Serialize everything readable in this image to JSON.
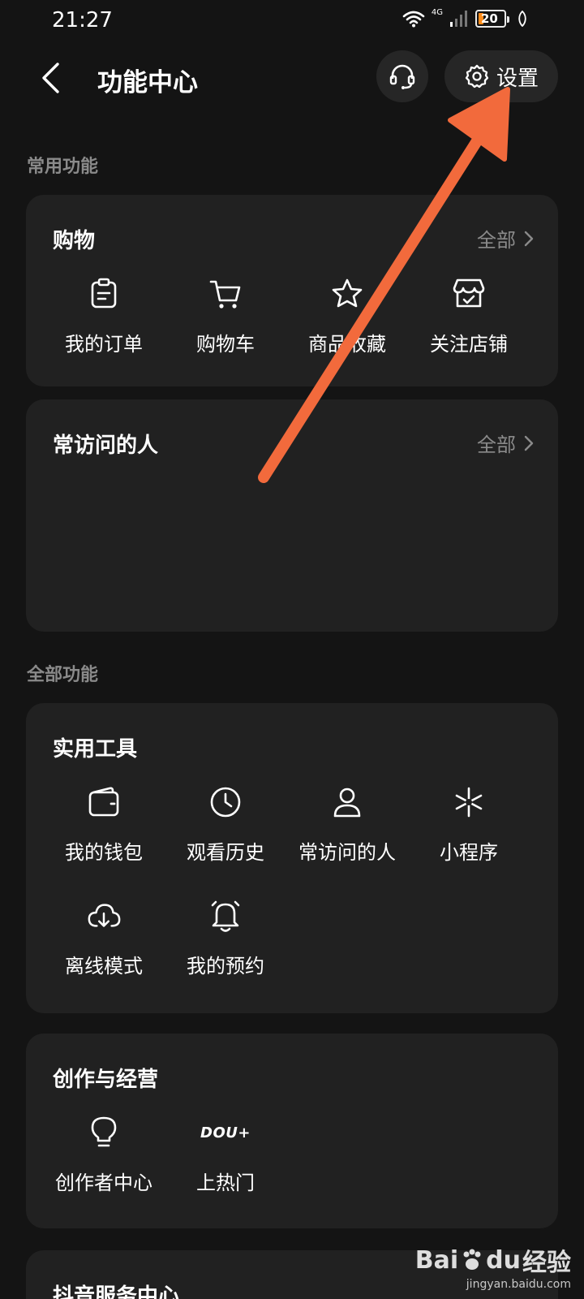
{
  "status_bar": {
    "time": "21:27",
    "network": "4G",
    "battery": "20",
    "battery_level": 0.2
  },
  "header": {
    "title": "功能中心",
    "settings_label": "设置"
  },
  "sections": {
    "common": "常用功能",
    "all": "全部功能"
  },
  "shopping": {
    "title": "购物",
    "see_all": "全部",
    "items": [
      {
        "label": "我的订单",
        "icon": "order-icon"
      },
      {
        "label": "购物车",
        "icon": "cart-icon"
      },
      {
        "label": "商品收藏",
        "icon": "star-icon"
      },
      {
        "label": "关注店铺",
        "icon": "store-icon"
      }
    ]
  },
  "frequent": {
    "title": "常访问的人",
    "see_all": "全部"
  },
  "tools": {
    "title": "实用工具",
    "items": [
      {
        "label": "我的钱包",
        "icon": "wallet-icon"
      },
      {
        "label": "观看历史",
        "icon": "clock-icon"
      },
      {
        "label": "常访问的人",
        "icon": "person-icon"
      },
      {
        "label": "小程序",
        "icon": "mini-program-icon"
      },
      {
        "label": "离线模式",
        "icon": "cloud-download-icon"
      },
      {
        "label": "我的预约",
        "icon": "bell-icon"
      }
    ]
  },
  "creation": {
    "title": "创作与经营",
    "items": [
      {
        "label": "创作者中心",
        "icon": "lightbulb-icon"
      },
      {
        "label": "上热门",
        "icon": "dou-plus-icon",
        "icon_text": "DOU+"
      }
    ]
  },
  "service": {
    "title": "抖音服务中心"
  },
  "watermark": {
    "logo_left": "Bai",
    "logo_mid": "du",
    "logo_right": "经验",
    "url": "jingyan.baidu.com"
  },
  "colors": {
    "background": "#141414",
    "card": "#212121",
    "muted": "#8a8a8a",
    "arrow": "#f26a3c",
    "battery": "#ff8c1a"
  }
}
